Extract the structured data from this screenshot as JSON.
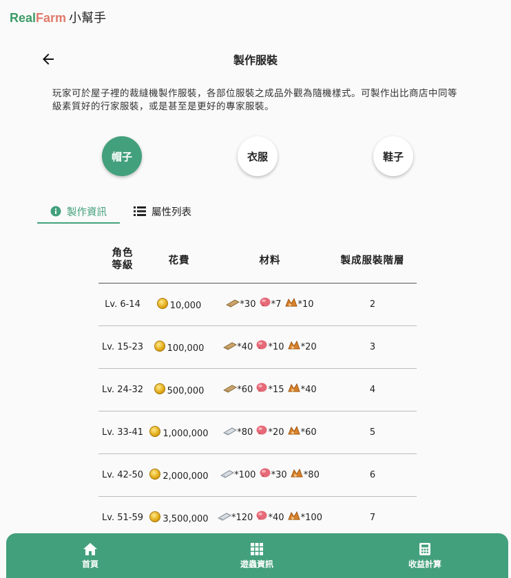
{
  "brand": {
    "part1": "Real",
    "part2": "Farm",
    "suffix": "小幫手"
  },
  "page": {
    "title": "製作服裝",
    "description": "玩家可於屋子裡的裁縫機製作服裝，各部位服裝之成品外觀為隨機樣式。可製作出比商店中同等級素質好的行家服裝，或是甚至是更好的專家服裝。"
  },
  "categories": [
    {
      "label": "帽子",
      "active": true
    },
    {
      "label": "衣服",
      "active": false
    },
    {
      "label": "鞋子",
      "active": false
    }
  ],
  "tabs": [
    {
      "label": "製作資訊",
      "icon": "info-icon",
      "active": true
    },
    {
      "label": "屬性列表",
      "icon": "list-icon",
      "active": false
    }
  ],
  "table": {
    "headers": {
      "level": "角色\n等級",
      "cost": "花費",
      "materials": "材料",
      "tier": "製成服裝階層"
    },
    "rows": [
      {
        "level": "Lv. 6-14",
        "cost": "10,000",
        "m1_icon": "cloth-icon",
        "m1": "*30",
        "m2_icon": "pink-ball-icon",
        "m2": "*7",
        "m3_icon": "ore-icon",
        "m3": "*10",
        "tier": "2"
      },
      {
        "level": "Lv. 15-23",
        "cost": "100,000",
        "m1_icon": "cloth-icon",
        "m1": "*40",
        "m2_icon": "pink-ball-icon",
        "m2": "*10",
        "m3_icon": "ore-icon",
        "m3": "*20",
        "tier": "3"
      },
      {
        "level": "Lv. 24-32",
        "cost": "500,000",
        "m1_icon": "cloth-icon",
        "m1": "*60",
        "m2_icon": "pink-ball-icon",
        "m2": "*15",
        "m3_icon": "ore-icon",
        "m3": "*40",
        "tier": "4"
      },
      {
        "level": "Lv. 33-41",
        "cost": "1,000,000",
        "m1_icon": "silver-cloth-icon",
        "m1": "*80",
        "m2_icon": "pink-ball-icon",
        "m2": "*20",
        "m3_icon": "ore-icon",
        "m3": "*60",
        "tier": "5"
      },
      {
        "level": "Lv. 42-50",
        "cost": "2,000,000",
        "m1_icon": "silver-cloth-icon",
        "m1": "*100",
        "m2_icon": "pink-ball-icon",
        "m2": "*30",
        "m3_icon": "ore-icon",
        "m3": "*80",
        "tier": "6"
      },
      {
        "level": "Lv. 51-59",
        "cost": "3,500,000",
        "m1_icon": "silver-cloth-icon",
        "m1": "*120",
        "m2_icon": "pink-ball-icon",
        "m2": "*40",
        "m3_icon": "ore-icon",
        "m3": "*100",
        "tier": "7"
      }
    ]
  },
  "bottom_nav": [
    {
      "label": "首頁",
      "icon": "home-icon"
    },
    {
      "label": "遊蟲資訊",
      "icon": "grid-icon"
    },
    {
      "label": "收益計算",
      "icon": "calculator-icon"
    }
  ],
  "colors": {
    "accent": "#43a07c",
    "brand_green": "#3a9b66",
    "brand_red": "#e07a6a"
  }
}
